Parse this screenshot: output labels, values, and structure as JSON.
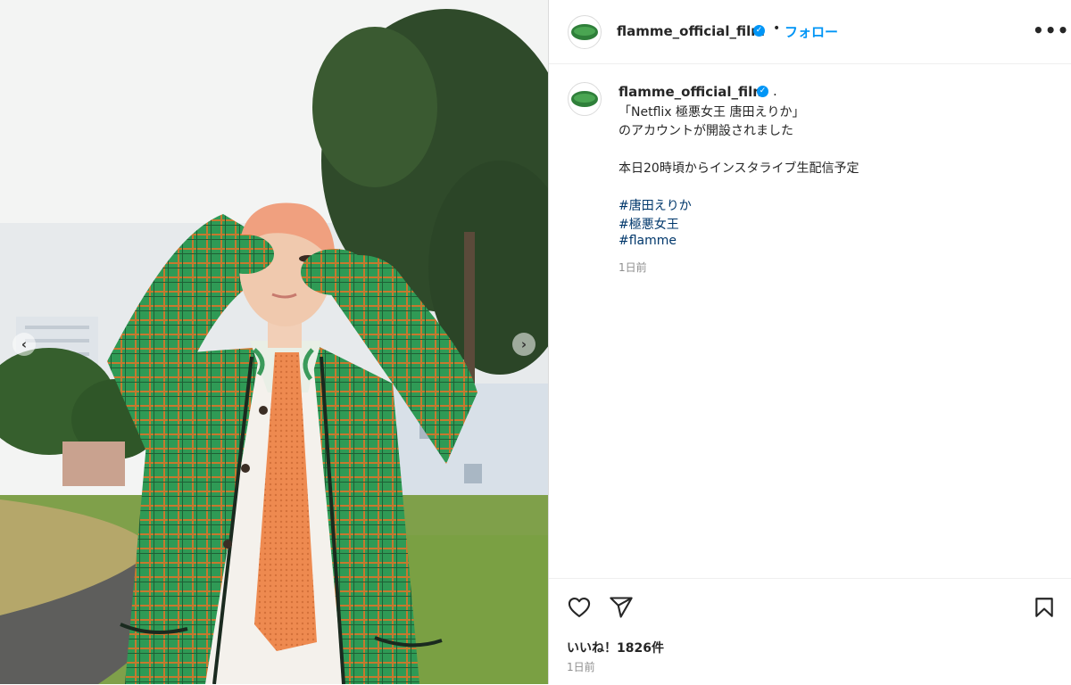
{
  "post": {
    "username": "flamme_official_film",
    "follow_label": "フォロー",
    "header_dot": "•",
    "more_label": "•••",
    "verified_mark": "✓",
    "caption_dot": ".",
    "caption_lines": [
      "「Netflix 極悪女王 唐田えりか」",
      "のアカウントが開設されました",
      "本日20時頃からインスタライブ生配信予定"
    ],
    "hashtags": [
      "#唐田えりか",
      "#極悪女王",
      "#flamme"
    ],
    "comment_time": "1日前",
    "likes": "いいね！1826件",
    "post_date": "1日前"
  },
  "carousel": {
    "prev_label": "‹",
    "next_label": "›"
  },
  "colors": {
    "accent": "#0095f6",
    "hashtag": "#00376b",
    "coat": "#2e8b4e",
    "tie": "#e9834a"
  }
}
